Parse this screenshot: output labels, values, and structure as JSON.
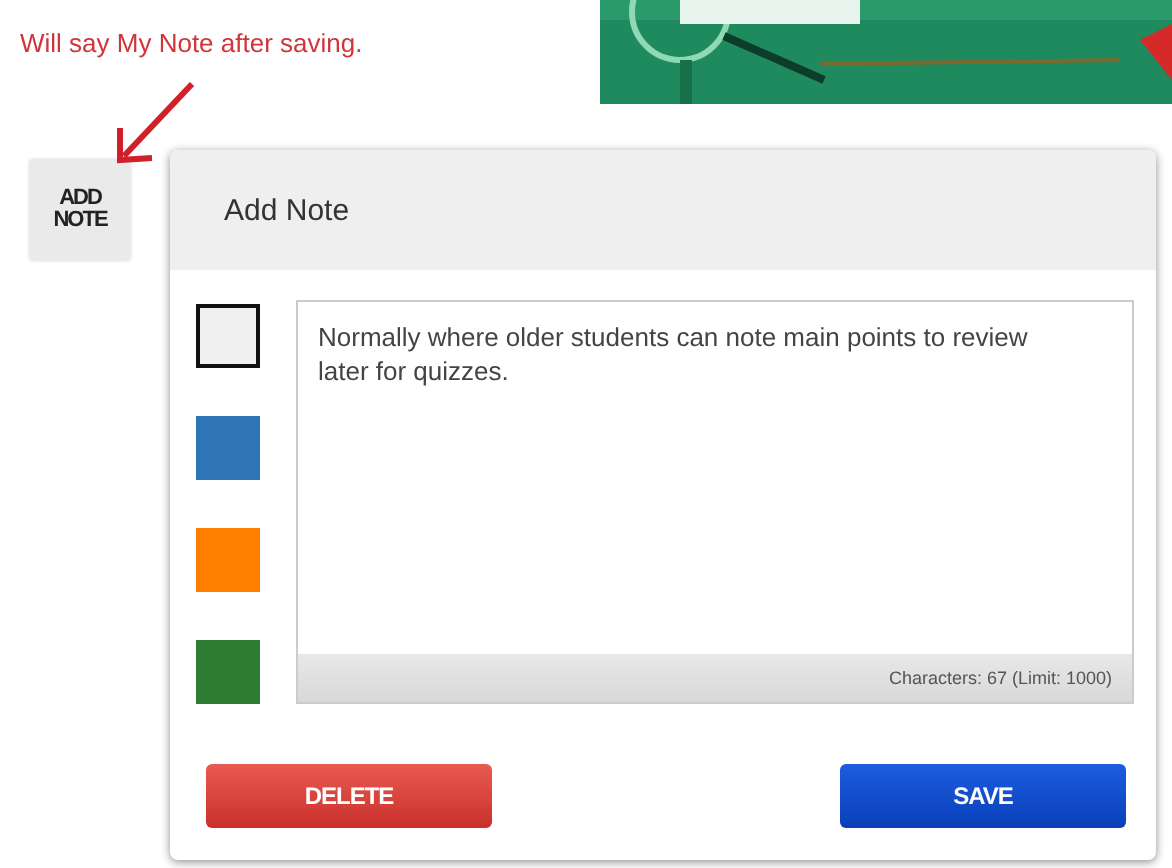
{
  "annotation": {
    "text": "Will say My Note after saving."
  },
  "add_note_button": {
    "label": "ADD NOTE"
  },
  "dialog": {
    "title": "Add Note",
    "swatches": [
      {
        "color": "#f0f0f0",
        "selected": true
      },
      {
        "color": "#2e75b6",
        "selected": false
      },
      {
        "color": "#ff8000",
        "selected": false
      },
      {
        "color": "#2e7d32",
        "selected": false
      }
    ],
    "note": {
      "value": "Normally where older students can note main points to review later for quizzes.",
      "counter": "Characters: 67 (Limit: 1000)"
    },
    "buttons": [
      {
        "kind": "delete",
        "label": "DELETE"
      },
      {
        "kind": "save",
        "label": "SAVE"
      }
    ]
  }
}
